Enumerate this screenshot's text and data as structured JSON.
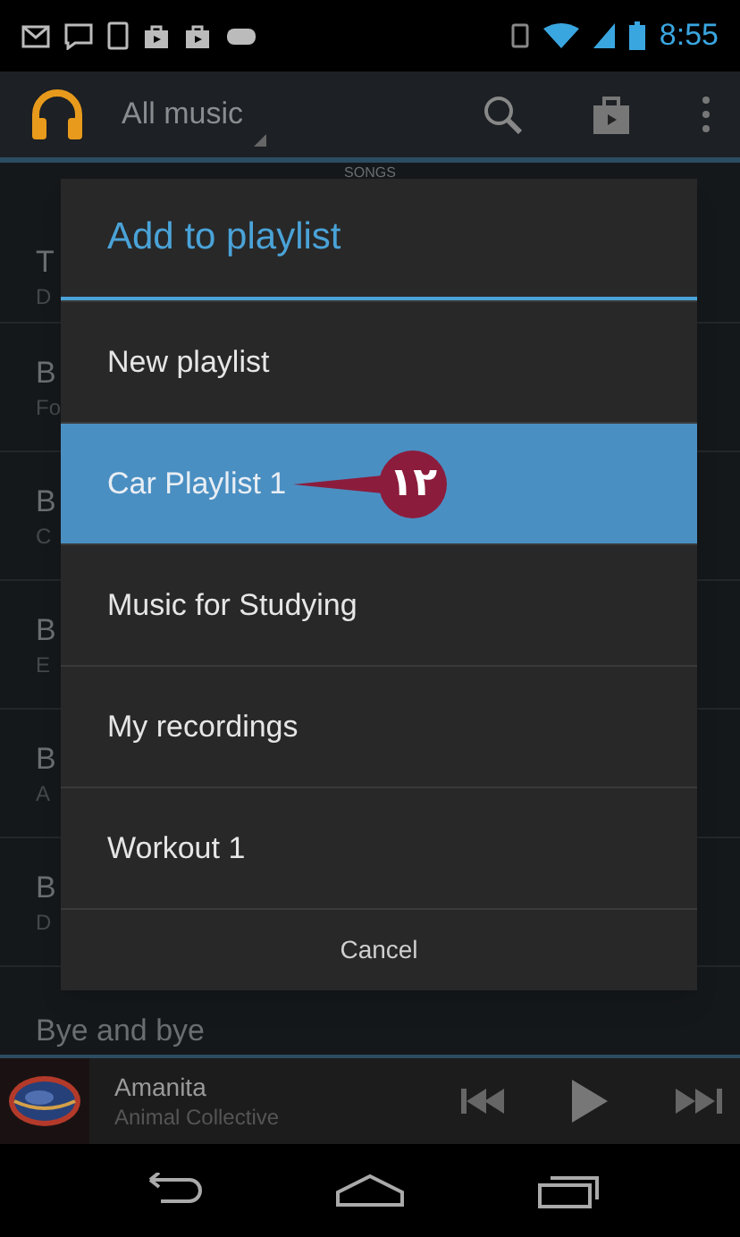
{
  "status_bar": {
    "time": "8:55"
  },
  "action_bar": {
    "title": "All music"
  },
  "tabs": [
    {
      "label": "SONGS",
      "selected": true
    }
  ],
  "background_list": [
    {
      "title": "T",
      "subtitle": "D"
    },
    {
      "title": "B",
      "subtitle": "Fo"
    },
    {
      "title": "B",
      "subtitle": "C"
    },
    {
      "title": "B",
      "subtitle": "E"
    },
    {
      "title": "B",
      "subtitle": "A"
    },
    {
      "title": "B",
      "subtitle": "D"
    },
    {
      "title": "Bye and bye"
    }
  ],
  "dialog": {
    "title": "Add to playlist",
    "items": [
      {
        "label": "New playlist",
        "selected": false
      },
      {
        "label": "Car Playlist 1",
        "selected": true,
        "callout": "۱۲"
      },
      {
        "label": "Music for Studying",
        "selected": false
      },
      {
        "label": "My recordings",
        "selected": false
      },
      {
        "label": "Workout 1",
        "selected": false
      }
    ],
    "cancel": "Cancel"
  },
  "now_playing": {
    "title": "Amanita",
    "artist": "Animal Collective"
  }
}
